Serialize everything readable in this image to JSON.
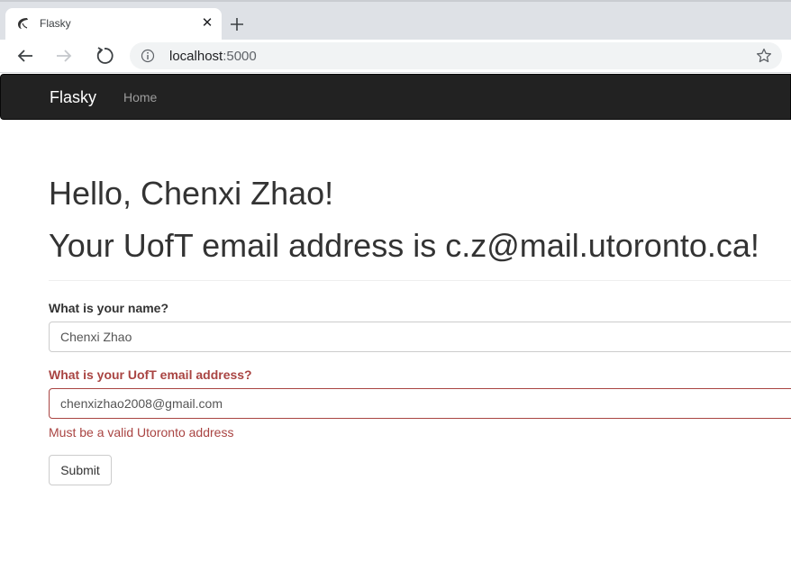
{
  "browser": {
    "tab_title": "Flasky",
    "tab_close_glyph": "✕",
    "url_host": "localhost",
    "url_port": ":5000",
    "icons": [
      "tab-favicon-icon",
      "close-icon",
      "new-tab-icon",
      "back-arrow-icon",
      "forward-arrow-icon",
      "reload-icon",
      "info-icon",
      "star-icon"
    ]
  },
  "navbar": {
    "brand": "Flasky",
    "links": [
      "Home"
    ]
  },
  "main": {
    "greeting": "Hello, Chenxi Zhao!",
    "email_message": "Your UofT email address is c.z@mail.utoronto.ca!"
  },
  "form": {
    "name_label": "What is your name?",
    "name_value": "Chenxi Zhao",
    "email_label": "What is your UofT email address?",
    "email_value": "chenxizhao2008@gmail.com",
    "email_error": "Must be a valid Utoronto address",
    "submit_label": "Submit"
  },
  "colors": {
    "navbar_bg": "#222222",
    "error": "#a94442",
    "chrome_bg": "#dee1e6"
  }
}
